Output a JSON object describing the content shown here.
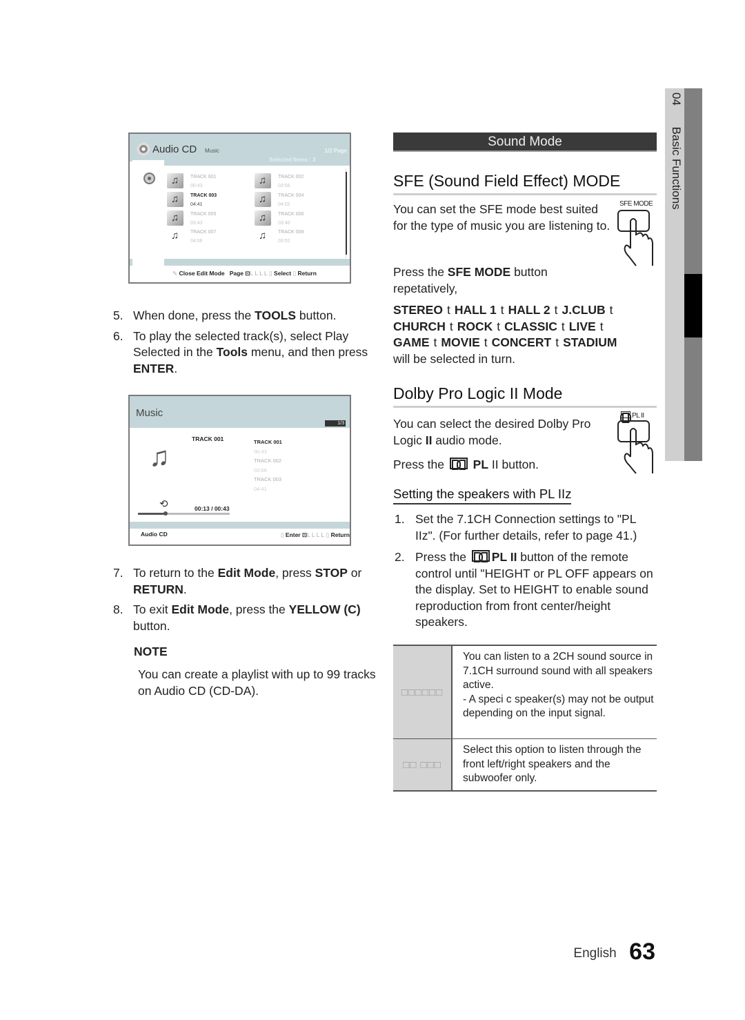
{
  "side_tab": {
    "chapter_number": "04",
    "chapter_title": "Basic Functions"
  },
  "screen_edit": {
    "title": "Audio CD",
    "subtitle": "Music",
    "page_indicator": "1/2 Page",
    "selected_items": "Selected Items : 3",
    "tracks": [
      {
        "name": "TRACK 001",
        "time": "00:43",
        "active": false
      },
      {
        "name": "TRACK 002",
        "time": "03:56",
        "active": false
      },
      {
        "name": "TRACK 003",
        "time": "04:41",
        "active": true
      },
      {
        "name": "TRACK 004",
        "time": "04:02",
        "active": false
      },
      {
        "name": "TRACK 005",
        "time": "03:43",
        "active": false
      },
      {
        "name": "TRACK 006",
        "time": "03:40",
        "active": false
      },
      {
        "name": "TRACK 007",
        "time": "04:06",
        "active": false
      },
      {
        "name": "TRACK 008",
        "time": "03:52",
        "active": false
      }
    ],
    "footer": {
      "close_edit": "Close Edit Mode",
      "page": "Page",
      "page_keys": "L L L L",
      "select": "Select",
      "return": "Return"
    }
  },
  "screen_play": {
    "title": "Music",
    "page_badge": "1/3",
    "now_playing": "TRACK 001",
    "list": [
      {
        "name": "TRACK 001",
        "time": "00:43",
        "active": true
      },
      {
        "name": "TRACK 002",
        "time": "03:56",
        "active": false
      },
      {
        "name": "TRACK 003",
        "time": "04:41",
        "active": false
      }
    ],
    "elapsed": "00:13 / 00:43",
    "progress_fraction": 0.3,
    "footer_left": "Audio CD",
    "footer": {
      "enter": "Enter",
      "keys": "L L L L",
      "return": "Return"
    }
  },
  "left_steps_1": [
    {
      "num": "5.",
      "parts": [
        "When done, press the ",
        "TOOLS",
        " button."
      ]
    },
    {
      "num": "6.",
      "parts": [
        "To play the selected track(s), select Play Selected in the ",
        "Tools",
        " menu, and then press ",
        "ENTER",
        "."
      ]
    }
  ],
  "left_steps_2": [
    {
      "num": "7.",
      "parts": [
        "To return to the ",
        "Edit Mode",
        ", press ",
        "STOP",
        " or ",
        "RETURN",
        "."
      ]
    },
    {
      "num": "8.",
      "parts": [
        "To exit ",
        "Edit Mode",
        ", press the ",
        "YELLOW (C)",
        " button."
      ]
    }
  ],
  "note": {
    "heading": "NOTE",
    "body": "You can create a playlist with up to 99 tracks on Audio CD (CD-DA)."
  },
  "sound_mode": {
    "bar_title": "Sound Mode",
    "sfe": {
      "heading": "SFE (Sound Field Effect) MODE",
      "intro": "You can set the SFE mode best suited for the type of music you are listening to.",
      "button_label": "SFE MODE",
      "press_pre": "Press the ",
      "press_bold": "SFE MODE",
      "press_post": " button repetatively,",
      "arrow": "t",
      "modes": [
        "STEREO",
        "HALL 1",
        "HALL 2",
        "J.CLUB",
        "CHURCH",
        "ROCK",
        "CLASSIC",
        "LIVE",
        "GAME",
        "MOVIE",
        "CONCERT",
        "STADIUM"
      ],
      "modes_tail": "will be selected in turn."
    },
    "dolby": {
      "heading": "Dolby Pro Logic II  Mode",
      "intro_pre": "You can select the desired Dolby Pro Logic ",
      "intro_bold": "II",
      "intro_post": " audio mode.",
      "button_label": "PL II",
      "press_pre": "Press the ",
      "press_bold": "PL",
      "press_post": " II  button."
    },
    "speakers": {
      "heading": "Setting the speakers with PL IIz",
      "steps": [
        {
          "num": "1.",
          "text": "Set the 7.1CH Connection settings to \"PL IIz\". (For further details, refer to page 41.)"
        },
        {
          "num": "2.",
          "pre": "Press the ",
          "bold": "PL II",
          "post": " button of the remote control until \"HEIGHT  or  PL OFF appears on the display. Set to  HEIGHT to enable sound reproduction from front center/height speakers."
        }
      ]
    },
    "options": [
      {
        "label": "□□□□□□",
        "desc": "You can listen to a 2CH sound source in 7.1CH surround sound with all speakers active.",
        "sub": "- A speci c speaker(s) may not be output depending on the input signal."
      },
      {
        "label": "□□ □□□",
        "desc": "Select this option to listen through the front left/right speakers and the subwoofer only.",
        "sub": ""
      }
    ]
  },
  "footer": {
    "language": "English",
    "page_number": "63"
  }
}
